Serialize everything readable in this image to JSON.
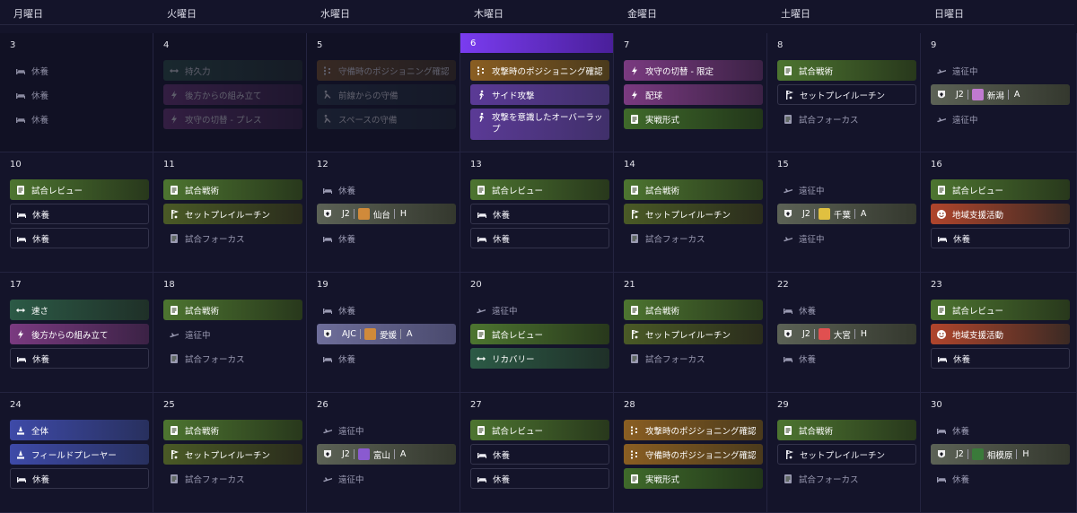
{
  "weekdays": [
    "月曜日",
    "火曜日",
    "水曜日",
    "木曜日",
    "金曜日",
    "土曜日",
    "日曜日"
  ],
  "today": "6",
  "colors": {
    "accent": "#7a3cf0",
    "background": "#14142a"
  },
  "weeks": [
    [
      {
        "day": "3",
        "past": true,
        "events": [
          {
            "kind": "text",
            "icon": "rest-icon",
            "label": "休養"
          },
          {
            "kind": "text",
            "icon": "rest-icon",
            "label": "休養"
          },
          {
            "kind": "text",
            "icon": "rest-icon",
            "label": "休養"
          }
        ]
      },
      {
        "day": "4",
        "past": true,
        "events": [
          {
            "kind": "teal",
            "icon": "endurance-icon",
            "label": "持久力"
          },
          {
            "kind": "purple",
            "icon": "bolt-icon",
            "label": "後方からの組み立て"
          },
          {
            "kind": "purple",
            "icon": "bolt-icon",
            "label": "攻守の切替 - プレス"
          }
        ]
      },
      {
        "day": "5",
        "past": true,
        "events": [
          {
            "kind": "orange",
            "icon": "positioning-icon",
            "label": "守備時のポジショニング確認"
          },
          {
            "kind": "slate",
            "icon": "defense-icon",
            "label": "前線からの守備"
          },
          {
            "kind": "slate",
            "icon": "defense-icon",
            "label": "スペースの守備"
          }
        ]
      },
      {
        "day": "6",
        "today": true,
        "events": [
          {
            "kind": "orange",
            "icon": "positioning-icon",
            "label": "攻撃時のポジショニング確認"
          },
          {
            "kind": "violet",
            "icon": "attack-icon",
            "label": "サイド攻撃"
          },
          {
            "kind": "violet",
            "icon": "attack-icon",
            "label": "攻撃を意識したオーバーラップ",
            "tall": true
          }
        ]
      },
      {
        "day": "7",
        "events": [
          {
            "kind": "purple",
            "icon": "bolt-icon",
            "label": "攻守の切替 - 限定"
          },
          {
            "kind": "purple",
            "icon": "bolt-icon",
            "label": "配球"
          },
          {
            "kind": "green",
            "icon": "document-icon",
            "label": "実戦形式"
          }
        ]
      },
      {
        "day": "8",
        "events": [
          {
            "kind": "tactics",
            "icon": "document-icon",
            "label": "試合戦術"
          },
          {
            "kind": "rest",
            "icon": "setpiece-icon",
            "label": "セットプレイルーチン"
          },
          {
            "kind": "text",
            "icon": "document-icon",
            "label": "試合フォーカス"
          }
        ]
      },
      {
        "day": "9",
        "events": [
          {
            "kind": "text",
            "icon": "travel-icon",
            "label": "遠征中"
          },
          {
            "kind": "match",
            "comp": "J2",
            "opp": "新潟",
            "ha": "A",
            "crest": "#c07ad0"
          },
          {
            "kind": "text",
            "icon": "travel-icon",
            "label": "遠征中"
          }
        ]
      }
    ],
    [
      {
        "day": "10",
        "events": [
          {
            "kind": "tactics",
            "icon": "document-icon",
            "label": "試合レビュー"
          },
          {
            "kind": "rest",
            "icon": "rest-icon",
            "label": "休養"
          },
          {
            "kind": "rest",
            "icon": "rest-icon",
            "label": "休養"
          }
        ]
      },
      {
        "day": "11",
        "events": [
          {
            "kind": "tactics",
            "icon": "document-icon",
            "label": "試合戦術"
          },
          {
            "kind": "setpiece",
            "icon": "setpiece-icon",
            "label": "セットプレイルーチン"
          },
          {
            "kind": "text",
            "icon": "document-icon",
            "label": "試合フォーカス"
          }
        ]
      },
      {
        "day": "12",
        "events": [
          {
            "kind": "text",
            "icon": "rest-icon",
            "label": "休養"
          },
          {
            "kind": "match",
            "comp": "J2",
            "opp": "仙台",
            "ha": "H",
            "crest": "#d08a3a"
          },
          {
            "kind": "text",
            "icon": "rest-icon",
            "label": "休養"
          }
        ]
      },
      {
        "day": "13",
        "events": [
          {
            "kind": "tactics",
            "icon": "document-icon",
            "label": "試合レビュー"
          },
          {
            "kind": "rest",
            "icon": "rest-icon",
            "label": "休養"
          },
          {
            "kind": "rest",
            "icon": "rest-icon",
            "label": "休養"
          }
        ]
      },
      {
        "day": "14",
        "events": [
          {
            "kind": "tactics",
            "icon": "document-icon",
            "label": "試合戦術"
          },
          {
            "kind": "setpiece",
            "icon": "setpiece-icon",
            "label": "セットプレイルーチン"
          },
          {
            "kind": "text",
            "icon": "document-icon",
            "label": "試合フォーカス"
          }
        ]
      },
      {
        "day": "15",
        "events": [
          {
            "kind": "text",
            "icon": "travel-icon",
            "label": "遠征中"
          },
          {
            "kind": "match",
            "comp": "J2",
            "opp": "千葉",
            "ha": "A",
            "crest": "#e0c040"
          },
          {
            "kind": "text",
            "icon": "travel-icon",
            "label": "遠征中"
          }
        ]
      },
      {
        "day": "16",
        "events": [
          {
            "kind": "tactics",
            "icon": "document-icon",
            "label": "試合レビュー"
          },
          {
            "kind": "red",
            "icon": "community-icon",
            "label": "地域支援活動"
          },
          {
            "kind": "rest",
            "icon": "rest-icon",
            "label": "休養"
          }
        ]
      }
    ],
    [
      {
        "day": "17",
        "events": [
          {
            "kind": "teal",
            "icon": "endurance-icon",
            "label": "速さ"
          },
          {
            "kind": "purple",
            "icon": "bolt-icon",
            "label": "後方からの組み立て"
          },
          {
            "kind": "rest",
            "icon": "rest-icon",
            "label": "休養"
          }
        ]
      },
      {
        "day": "18",
        "events": [
          {
            "kind": "tactics",
            "icon": "document-icon",
            "label": "試合戦術"
          },
          {
            "kind": "text",
            "icon": "travel-icon",
            "label": "遠征中"
          },
          {
            "kind": "text",
            "icon": "document-icon",
            "label": "試合フォーカス"
          }
        ]
      },
      {
        "day": "19",
        "events": [
          {
            "kind": "text",
            "icon": "rest-icon",
            "label": "休養"
          },
          {
            "kind": "matchp",
            "comp": "AJC",
            "opp": "愛媛",
            "ha": "A",
            "crest": "#d08a3a"
          },
          {
            "kind": "text",
            "icon": "rest-icon",
            "label": "休養"
          }
        ]
      },
      {
        "day": "20",
        "events": [
          {
            "kind": "text",
            "icon": "travel-icon",
            "label": "遠征中"
          },
          {
            "kind": "tactics",
            "icon": "document-icon",
            "label": "試合レビュー"
          },
          {
            "kind": "teal",
            "icon": "recovery-icon",
            "label": "リカバリー"
          }
        ]
      },
      {
        "day": "21",
        "events": [
          {
            "kind": "tactics",
            "icon": "document-icon",
            "label": "試合戦術"
          },
          {
            "kind": "setpiece",
            "icon": "setpiece-icon",
            "label": "セットプレイルーチン"
          },
          {
            "kind": "text",
            "icon": "document-icon",
            "label": "試合フォーカス"
          }
        ]
      },
      {
        "day": "22",
        "events": [
          {
            "kind": "text",
            "icon": "rest-icon",
            "label": "休養"
          },
          {
            "kind": "match",
            "comp": "J2",
            "opp": "大宮",
            "ha": "H",
            "crest": "#e05050"
          },
          {
            "kind": "text",
            "icon": "rest-icon",
            "label": "休養"
          }
        ]
      },
      {
        "day": "23",
        "events": [
          {
            "kind": "tactics",
            "icon": "document-icon",
            "label": "試合レビュー"
          },
          {
            "kind": "red",
            "icon": "community-icon",
            "label": "地域支援活動"
          },
          {
            "kind": "rest",
            "icon": "rest-icon",
            "label": "休養"
          }
        ]
      }
    ],
    [
      {
        "day": "24",
        "events": [
          {
            "kind": "blue",
            "icon": "team-icon",
            "label": "全体"
          },
          {
            "kind": "blue",
            "icon": "team-icon",
            "label": "フィールドプレーヤー"
          },
          {
            "kind": "rest",
            "icon": "rest-icon",
            "label": "休養"
          }
        ]
      },
      {
        "day": "25",
        "events": [
          {
            "kind": "tactics",
            "icon": "document-icon",
            "label": "試合戦術"
          },
          {
            "kind": "setpiece",
            "icon": "setpiece-icon",
            "label": "セットプレイルーチン"
          },
          {
            "kind": "text",
            "icon": "document-icon",
            "label": "試合フォーカス"
          }
        ]
      },
      {
        "day": "26",
        "events": [
          {
            "kind": "text",
            "icon": "travel-icon",
            "label": "遠征中"
          },
          {
            "kind": "match",
            "comp": "J2",
            "opp": "富山",
            "ha": "A",
            "crest": "#8a5ad0"
          },
          {
            "kind": "text",
            "icon": "travel-icon",
            "label": "遠征中"
          }
        ]
      },
      {
        "day": "27",
        "events": [
          {
            "kind": "tactics",
            "icon": "document-icon",
            "label": "試合レビュー"
          },
          {
            "kind": "rest",
            "icon": "rest-icon",
            "label": "休養"
          },
          {
            "kind": "rest",
            "icon": "rest-icon",
            "label": "休養"
          }
        ]
      },
      {
        "day": "28",
        "events": [
          {
            "kind": "orange",
            "icon": "positioning-icon",
            "label": "攻撃時のポジショニング確認"
          },
          {
            "kind": "orange",
            "icon": "positioning-icon",
            "label": "守備時のポジショニング確認"
          },
          {
            "kind": "green",
            "icon": "document-icon",
            "label": "実戦形式"
          }
        ]
      },
      {
        "day": "29",
        "events": [
          {
            "kind": "tactics",
            "icon": "document-icon",
            "label": "試合戦術"
          },
          {
            "kind": "rest",
            "icon": "setpiece-icon",
            "label": "セットプレイルーチン"
          },
          {
            "kind": "text",
            "icon": "document-icon",
            "label": "試合フォーカス"
          }
        ]
      },
      {
        "day": "30",
        "events": [
          {
            "kind": "text",
            "icon": "rest-icon",
            "label": "休養"
          },
          {
            "kind": "match",
            "comp": "J2",
            "opp": "相模原",
            "ha": "H",
            "crest": "#3a7a3a"
          },
          {
            "kind": "text",
            "icon": "rest-icon",
            "label": "休養"
          }
        ]
      }
    ]
  ]
}
